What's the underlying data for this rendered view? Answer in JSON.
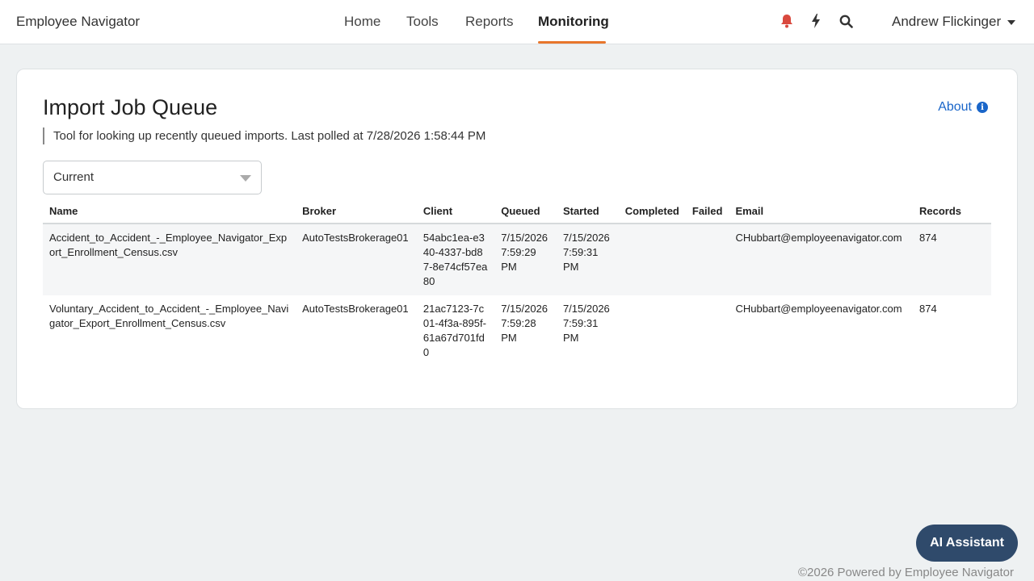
{
  "nav": {
    "brand": "Employee Navigator",
    "items": [
      {
        "label": "Home"
      },
      {
        "label": "Tools"
      },
      {
        "label": "Reports"
      },
      {
        "label": "Monitoring",
        "active": true
      }
    ],
    "icons": [
      "bell-icon",
      "bolt-icon",
      "search-icon"
    ],
    "user": "Andrew Flickinger"
  },
  "page": {
    "title": "Import Job Queue",
    "about_label": "About",
    "subtitle": "Tool for looking up recently queued imports. Last polled at 7/28/2026 1:58:44 PM",
    "filter_value": "Current"
  },
  "table": {
    "columns": [
      "Name",
      "Broker",
      "Client",
      "Queued",
      "Started",
      "Completed",
      "Failed",
      "Email",
      "Records"
    ],
    "rows": [
      {
        "name": "Accident_to_Accident_-_Employee_Navigator_Export_Enrollment_Census.csv",
        "broker": "AutoTestsBrokerage01",
        "client": "54abc1ea-e340-4337-bd87-8e74cf57ea80",
        "queued": "7/15/2026 7:59:29 PM",
        "started": "7/15/2026 7:59:31 PM",
        "completed": "",
        "failed": "",
        "email": "CHubbart@employeenavigator.com",
        "records": "874"
      },
      {
        "name": "Voluntary_Accident_to_Accident_-_Employee_Navigator_Export_Enrollment_Census.csv",
        "broker": "AutoTestsBrokerage01",
        "client": "21ac7123-7c01-4f3a-895f-61a67d701fd0",
        "queued": "7/15/2026 7:59:28 PM",
        "started": "7/15/2026 7:59:31 PM",
        "completed": "",
        "failed": "",
        "email": "CHubbart@employeenavigator.com",
        "records": "874"
      }
    ]
  },
  "ai_assistant_label": "AI Assistant",
  "footer": "©2026 Powered by Employee Navigator",
  "colors": {
    "accent": "#e8762c",
    "link": "#1a66c9",
    "bell": "#d9493e",
    "ai_button": "#2f4a6b"
  }
}
